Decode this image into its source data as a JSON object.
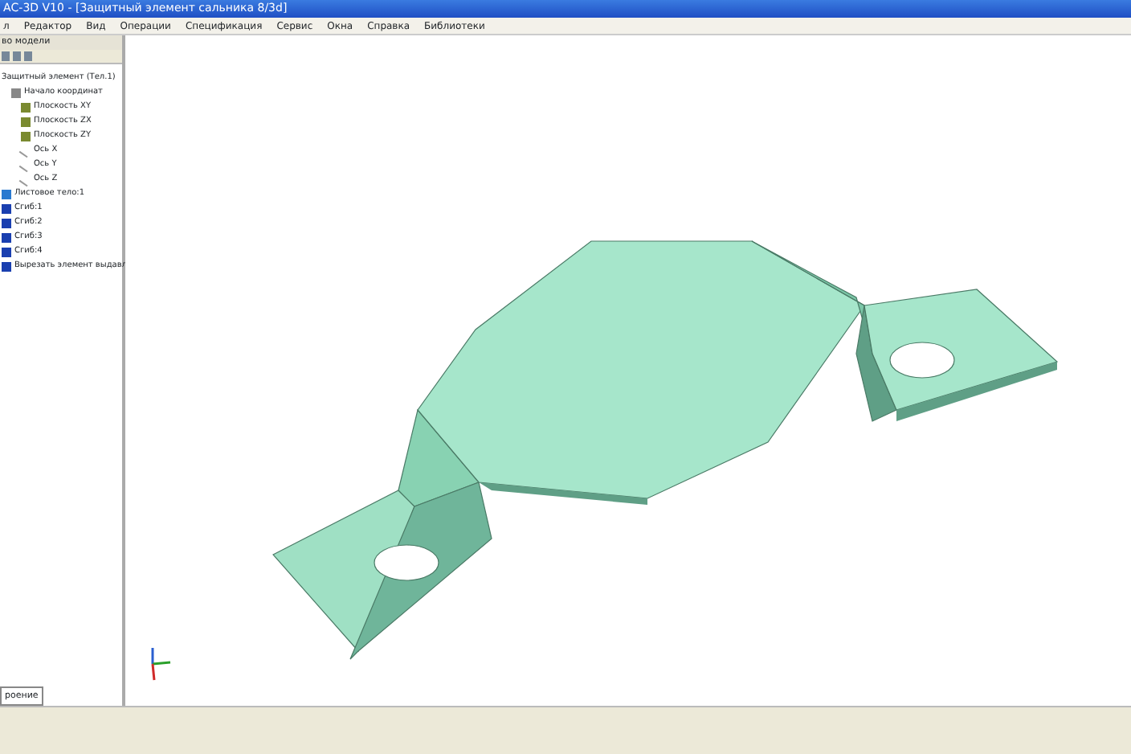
{
  "window": {
    "title": "АС-3D V10 - [Защитный элемент сальника 8/3d]"
  },
  "menu": [
    "л",
    "Редактор",
    "Вид",
    "Операции",
    "Спецификация",
    "Сервис",
    "Окна",
    "Справка",
    "Библиотеки"
  ],
  "tree_panel": {
    "title": "во модели",
    "items": [
      {
        "label": "Защитный элемент (Тел.1)",
        "kind": "root",
        "children": [
          {
            "label": "Начало координат",
            "kind": "origin",
            "children": [
              {
                "label": "Плоскость XY",
                "kind": "plane"
              },
              {
                "label": "Плоскость ZX",
                "kind": "plane"
              },
              {
                "label": "Плоскость ZY",
                "kind": "plane"
              },
              {
                "label": "Ось X",
                "kind": "axis"
              },
              {
                "label": "Ось Y",
                "kind": "axis"
              },
              {
                "label": "Ось Z",
                "kind": "axis"
              }
            ]
          }
        ]
      },
      {
        "label": "Листовое тело:1",
        "kind": "sheet"
      },
      {
        "label": "Сгиб:1",
        "kind": "bend"
      },
      {
        "label": "Сгиб:2",
        "kind": "bend"
      },
      {
        "label": "Сгиб:3",
        "kind": "bend"
      },
      {
        "label": "Сгиб:4",
        "kind": "bend"
      },
      {
        "label": "Вырезать элемент выдавл",
        "kind": "cut"
      }
    ],
    "bottom_tab": {
      "label": "роение",
      "selected": true
    }
  }
}
